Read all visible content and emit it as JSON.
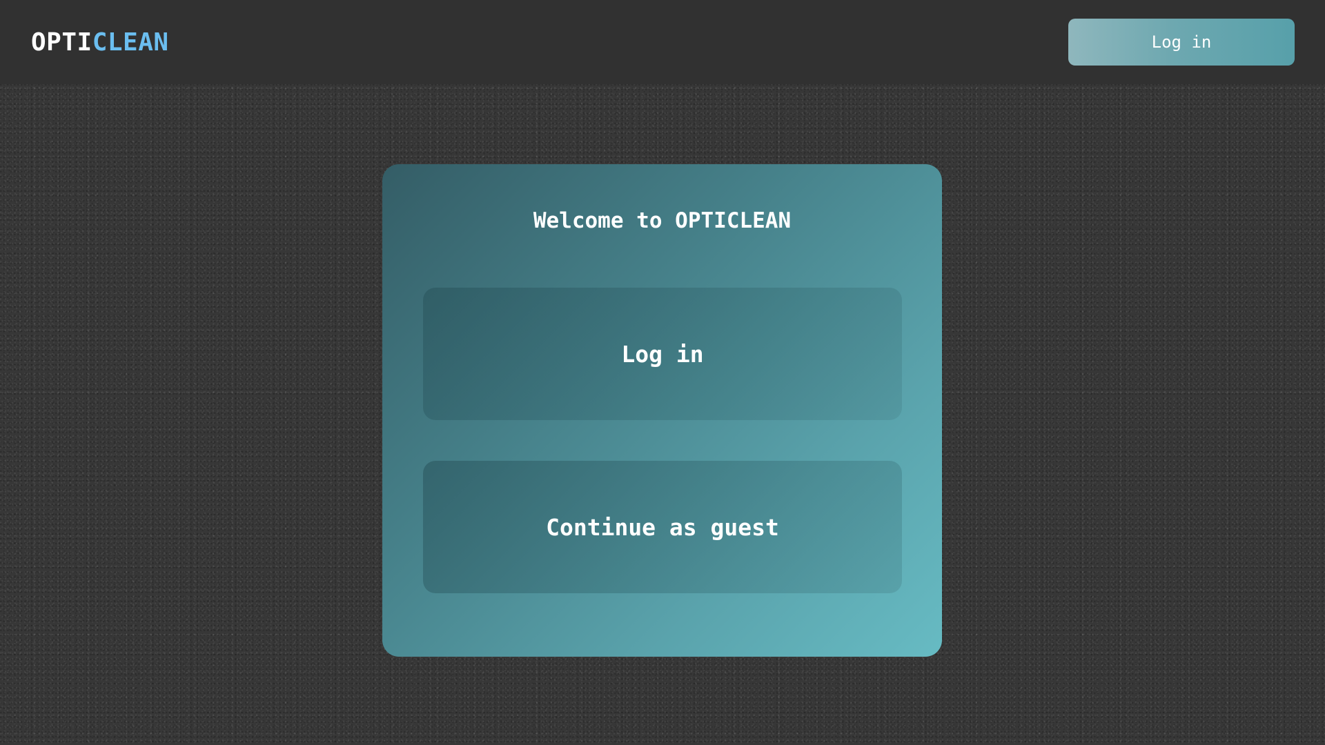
{
  "header": {
    "brand_part1": "OPTI",
    "brand_part2": "CLEAN",
    "login_label": "Log in"
  },
  "card": {
    "title": "Welcome to OPTICLEAN",
    "login_label": "Log in",
    "guest_label": "Continue as guest"
  },
  "colors": {
    "background": "#373737",
    "topbar": "#313131",
    "brand_accent": "#6bbef0",
    "card_gradient_start": "#345d66",
    "card_gradient_end": "#67bbc3"
  }
}
